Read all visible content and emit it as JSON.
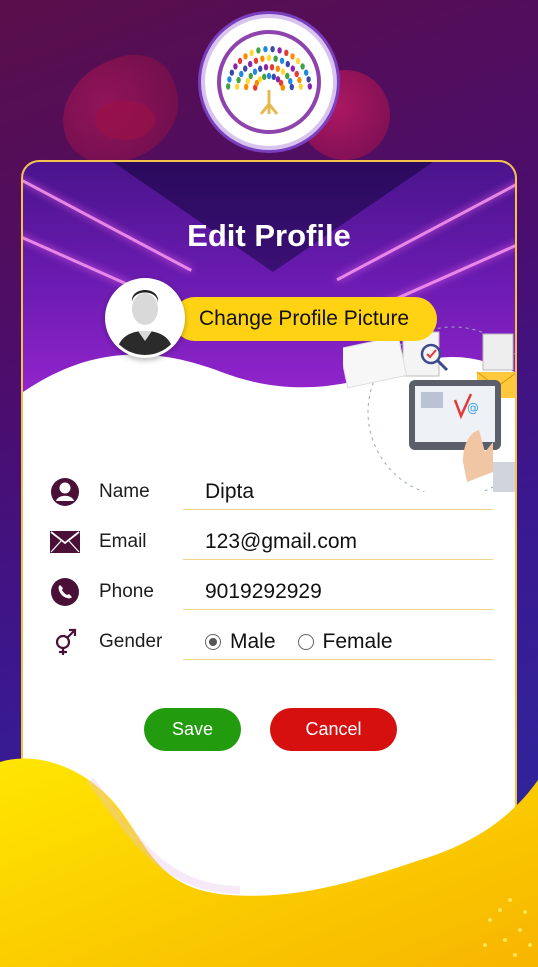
{
  "header": {
    "title": "Edit Profile"
  },
  "profile": {
    "change_picture_label": "Change Profile Picture"
  },
  "form": {
    "name": {
      "label": "Name",
      "value": "Dipta",
      "icon": "user-circle-icon"
    },
    "email": {
      "label": "Email",
      "value": "123@gmail.com",
      "icon": "envelope-icon"
    },
    "phone": {
      "label": "Phone",
      "value": "9019292929",
      "icon": "phone-icon"
    },
    "gender": {
      "label": "Gender",
      "icon": "gender-icon",
      "options": [
        "Male",
        "Female"
      ],
      "selected": "Male"
    }
  },
  "actions": {
    "save_label": "Save",
    "cancel_label": "Cancel"
  },
  "colors": {
    "accent_yellow": "#ffd314",
    "save_green": "#239b0f",
    "cancel_red": "#d60f0f",
    "icon_purple": "#4a1038",
    "header_purple": "#6a1bb0"
  }
}
